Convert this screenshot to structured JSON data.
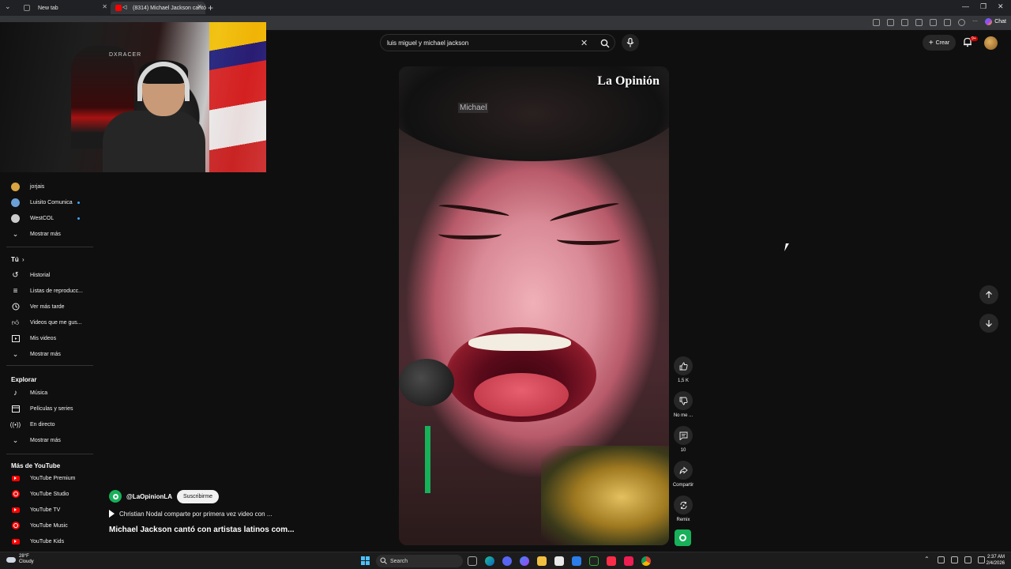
{
  "browser": {
    "tabs": [
      {
        "label": "New tab"
      },
      {
        "label": "(8314) Michael Jackson cantó"
      }
    ],
    "chat_label": "Chat"
  },
  "youtube": {
    "search": {
      "value": "luis miguel y michael jackson"
    },
    "create_label": "Crear",
    "notifications_badge": "9+"
  },
  "sidebar": {
    "subscriptions": [
      {
        "label": "jorjais",
        "color": "#d9a441"
      },
      {
        "label": "Luisito Comunica",
        "color": "#6aa0d8"
      },
      {
        "label": "WestCOL",
        "color": "#cccccc"
      }
    ],
    "show_more_1": "Mostrar más",
    "you_heading": "Tú",
    "you_items": [
      {
        "label": "Historial",
        "icon": "history-icon"
      },
      {
        "label": "Listas de reproducc...",
        "icon": "playlist-icon"
      },
      {
        "label": "Ver más tarde",
        "icon": "clock-icon"
      },
      {
        "label": "Videos que me gus...",
        "icon": "thumbs-up-icon"
      },
      {
        "label": "Mis videos",
        "icon": "my-videos-icon"
      }
    ],
    "show_more_2": "Mostrar más",
    "explore_heading": "Explorar",
    "explore_items": [
      {
        "label": "Música",
        "icon": "music-icon"
      },
      {
        "label": "Películas y series",
        "icon": "movies-icon"
      },
      {
        "label": "En directo",
        "icon": "live-icon"
      }
    ],
    "show_more_3": "Mostrar más",
    "more_heading": "Más de YouTube",
    "more_items": [
      {
        "label": "YouTube Premium"
      },
      {
        "label": "YouTube Studio"
      },
      {
        "label": "YouTube TV"
      },
      {
        "label": "YouTube Music"
      },
      {
        "label": "YouTube Kids"
      }
    ]
  },
  "webcam": {
    "chair_logo": "DXRACER"
  },
  "short": {
    "brand": "La Opinión",
    "caption": "Michael",
    "actions": {
      "likes": "1,5 K",
      "dislike": "No me ...",
      "comments": "10",
      "share": "Compartir",
      "remix": "Remix"
    },
    "channel_handle": "@LaOpinionLA",
    "subscribe_label": "Suscribirme",
    "related": "Christian Nodal comparte por primera vez video con ...",
    "title": "Michael Jackson cantó con artistas latinos com..."
  },
  "taskbar": {
    "weather_temp": "28°F",
    "weather_desc": "Cloudy",
    "search_label": "Search",
    "time": "2:37 AM",
    "date": "2/4/2026"
  },
  "colors": {
    "accent_red": "#ff0000",
    "channel_green": "#17b15a",
    "background": "#0f0f0f"
  }
}
